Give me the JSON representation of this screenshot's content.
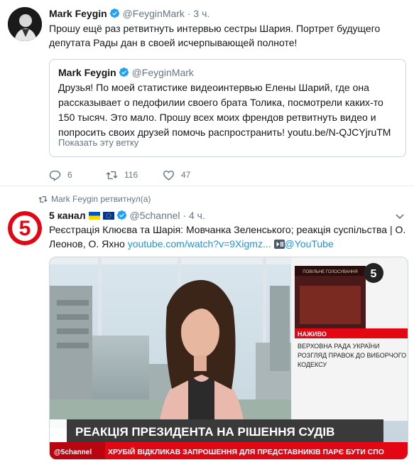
{
  "tweet1": {
    "name": "Mark Feygin",
    "handle": "@FeyginMark",
    "dot": "·",
    "time": "3 ч.",
    "text": "Прошу ещё раз ретвитнуть интервью сестры Шария. Портрет будущего депутата Рады дан в своей исчерпывающей полноте!",
    "quote": {
      "name": "Mark Feygin",
      "handle": "@FeyginMark",
      "text": "Друзья! По моей статистике видеоинтервью Елены Шарий, где она рассказывает о педофилии своего брата Толика, посмотрели каких-то 150 тысяч. Это мало. Прошу всех моих френдов ретвитнуть видео и попросить своих друзей помочь распространить! youtu.be/N-QJCYjruTM",
      "show_thread": "Показать эту ветку"
    },
    "actions": {
      "replies": "6",
      "retweets": "116",
      "likes": "47"
    }
  },
  "retweet_notice": "Mark Feygin ретвитнул(а)",
  "tweet2": {
    "name": "5 канал",
    "handle": "@5channel",
    "dot": "·",
    "time": "4 ч.",
    "text_plain": "Реєстрація Клюєва та Шарія: Мовчанка Зеленського; реакція суспільства | О. Леонов, О. Яхно ",
    "link_url": "youtube.com/watch?v=9Xigmz...",
    "link_via": "@YouTube",
    "video": {
      "logo": "5",
      "badge_top": "ПОВІЛЬНЕ ГОЛОСУВАННЯ",
      "live": "НАЖИВО",
      "news_line1": "ВЕРХОВНА РАДА УКРАЇНИ",
      "news_line2": "РОЗГЛЯД ПРАВОК ДО ВИБОРЧОГО",
      "news_line3": "КОДЕКСУ",
      "headline": "РЕАКЦІЯ ПРЕЗИДЕНТА НА РІШЕННЯ СУДІВ",
      "ticker_handle": "@5channel",
      "ticker": "ХРУБІЙ ВІДКЛИКАВ ЗАПРОШЕННЯ ДЛЯ ПРЕДСТАВНИКІВ ПАРЄ БУТИ СПО"
    }
  },
  "colors": {
    "accent": "#1da1f2",
    "link": "#1b95e0",
    "muted": "#657786",
    "channel5": "#e30613"
  }
}
